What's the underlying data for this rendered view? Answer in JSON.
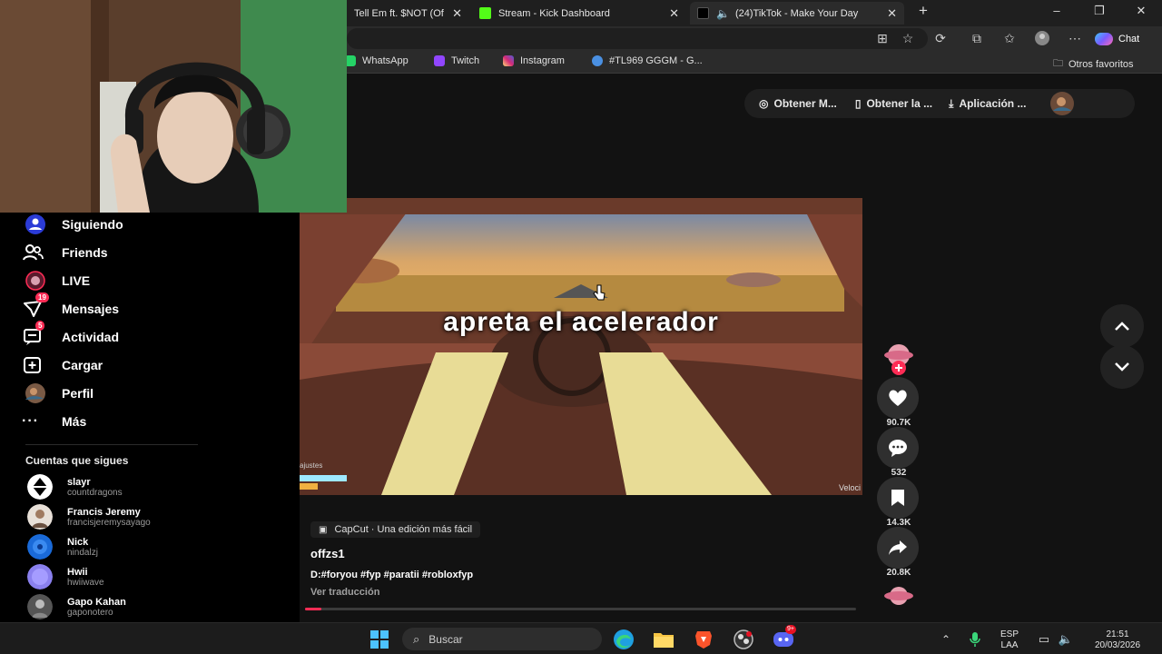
{
  "browser": {
    "tabs": [
      {
        "title": "Tell Em ft. $NOT (Of",
        "active": false
      },
      {
        "title": "Stream - Kick Dashboard",
        "active": false
      },
      {
        "title": "(24)TikTok - Make Your Day",
        "active": true
      }
    ],
    "chat_label": "Chat",
    "bookmarks": [
      "WhatsApp",
      "Twitch",
      "Instagram",
      "#TL969 GGGM - G...",
      "Otros favoritos"
    ]
  },
  "sidebar": {
    "items": [
      {
        "label": "Siguiendo",
        "icon": "following-icon"
      },
      {
        "label": "Friends",
        "icon": "friends-icon"
      },
      {
        "label": "LIVE",
        "icon": "live-icon"
      },
      {
        "label": "Mensajes",
        "icon": "messages-icon",
        "badge": "19"
      },
      {
        "label": "Actividad",
        "icon": "activity-icon",
        "badge": "5"
      },
      {
        "label": "Cargar",
        "icon": "upload-icon"
      },
      {
        "label": "Perfil",
        "icon": "profile-avatar"
      },
      {
        "label": "Más",
        "icon": "more-icon"
      }
    ],
    "following_title": "Cuentas que sigues",
    "following": [
      {
        "name": "slayr",
        "username": "countdragons"
      },
      {
        "name": "Francis Jeremy",
        "username": "francisjeremysayago"
      },
      {
        "name": "Nick",
        "username": "nindalzj"
      },
      {
        "name": "Hwii",
        "username": "hwiiwave"
      },
      {
        "name": "Gapo Kahan",
        "username": "gaponotero"
      }
    ]
  },
  "topbar": {
    "coins": "Obtener M...",
    "app_pc": "Obtener la ...",
    "app": "Aplicación ..."
  },
  "video": {
    "caption": "apreta el acelerador",
    "overlay_right": "Veloci",
    "overlay_left": "ajustes",
    "capcut": "CapCut · Una edición más fácil",
    "author": "offzs1",
    "description": "D:#foryou #fyp #paratii #robloxfyp",
    "translate": "Ver traducción",
    "progress": 0.03
  },
  "actions": {
    "likes": "90.7K",
    "comments": "532",
    "saves": "14.3K",
    "shares": "20.8K"
  },
  "taskbar": {
    "search": "Buscar",
    "lang_top": "ESP",
    "lang_bottom": "LAA",
    "time": "21:51",
    "date": "20/03/2026",
    "discord_badge": "9+"
  },
  "colors": {
    "accent": "#fe2c55",
    "background": "#121212"
  }
}
